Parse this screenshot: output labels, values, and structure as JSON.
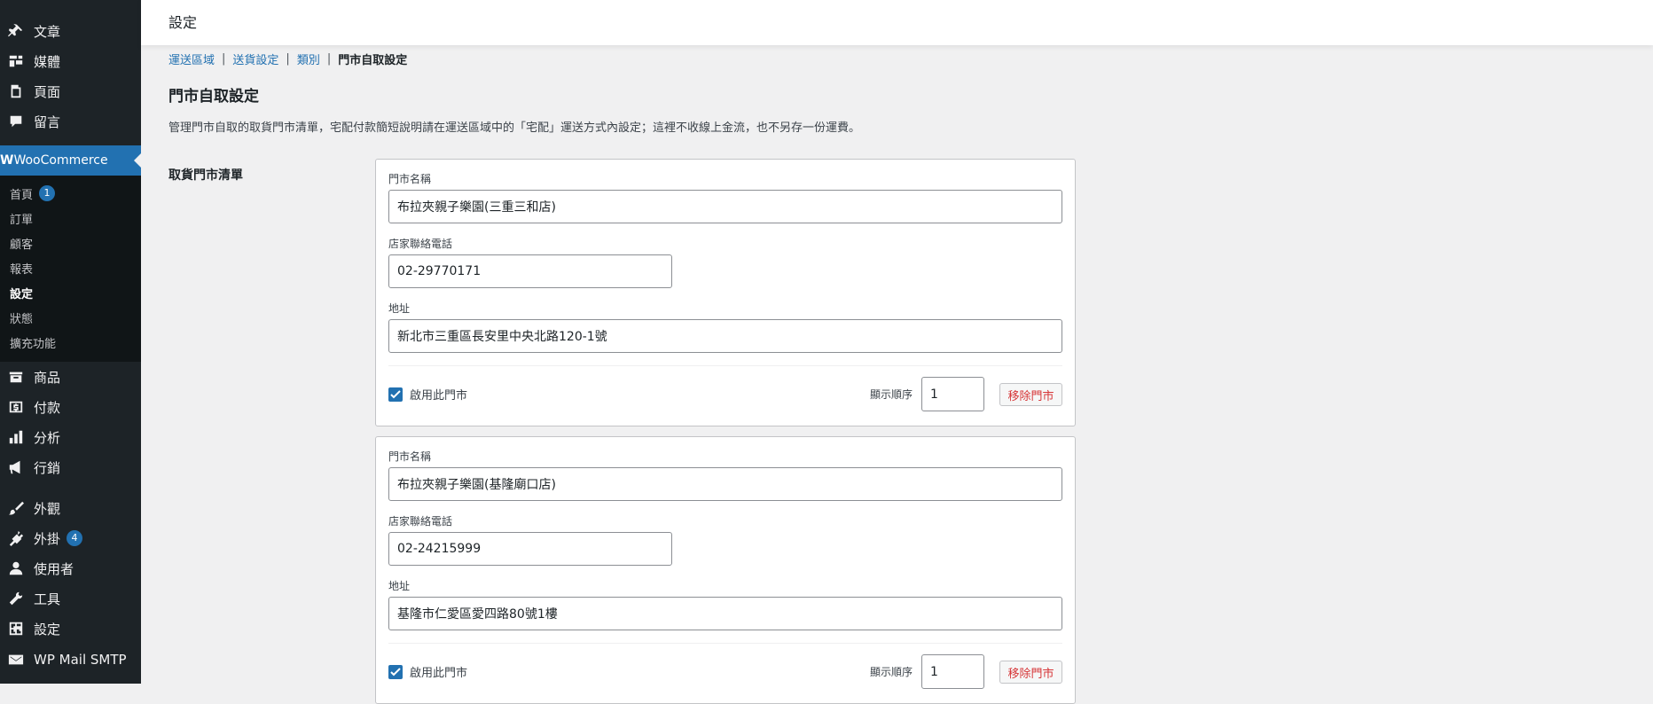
{
  "sidebar": {
    "top_items": [
      {
        "label": "文章",
        "icon": "pin-icon"
      },
      {
        "label": "媒體",
        "icon": "media-icon"
      },
      {
        "label": "頁面",
        "icon": "page-icon"
      },
      {
        "label": "留言",
        "icon": "comment-icon"
      }
    ],
    "woocommerce": {
      "label": "WooCommerce",
      "icon": "woo-icon"
    },
    "sub_items": [
      {
        "label": "首頁",
        "badge": "1"
      },
      {
        "label": "訂單"
      },
      {
        "label": "顧客"
      },
      {
        "label": "報表"
      },
      {
        "label": "設定",
        "current": true
      },
      {
        "label": "狀態"
      },
      {
        "label": "擴充功能"
      }
    ],
    "bottom_items": [
      {
        "label": "商品",
        "icon": "archive-icon"
      },
      {
        "label": "付款",
        "icon": "money-icon"
      },
      {
        "label": "分析",
        "icon": "chart-icon"
      },
      {
        "label": "行銷",
        "icon": "megaphone-icon"
      },
      {
        "label": "外觀",
        "icon": "brush-icon"
      },
      {
        "label": "外掛",
        "icon": "plug-icon",
        "badge": "4"
      },
      {
        "label": "使用者",
        "icon": "user-icon"
      },
      {
        "label": "工具",
        "icon": "wrench-icon"
      },
      {
        "label": "設定",
        "icon": "settings-icon"
      },
      {
        "label": "WP Mail SMTP",
        "icon": "mail-icon"
      }
    ]
  },
  "header": {
    "title": "設定"
  },
  "subnav": {
    "links": [
      "運送區域",
      "送貨設定",
      "類別"
    ],
    "current": "門市自取設定"
  },
  "section": {
    "title": "門市自取設定",
    "description": "管理門市自取的取貨門市清單，宅配付款簡短說明請在運送區域中的「宅配」運送方式內設定；這裡不收線上金流，也不另存一份運費。",
    "list_label": "取貨門市清單"
  },
  "labels": {
    "store_name": "門市名稱",
    "phone": "店家聯絡電話",
    "address": "地址",
    "enable": "啟用此門市",
    "order": "顯示順序",
    "remove": "移除門市"
  },
  "stores": [
    {
      "name": "布拉夾親子樂園(三重三和店)",
      "phone": "02-29770171",
      "address": "新北市三重區長安里中央北路120-1號",
      "order": "1",
      "enabled": true
    },
    {
      "name": "布拉夾親子樂園(基隆廟口店)",
      "phone": "02-24215999",
      "address": "基隆市仁愛區愛四路80號1樓",
      "order": "1",
      "enabled": true
    }
  ],
  "colors": {
    "sidebar": "#1d2327",
    "accent": "#2271b1",
    "danger": "#d63638"
  }
}
